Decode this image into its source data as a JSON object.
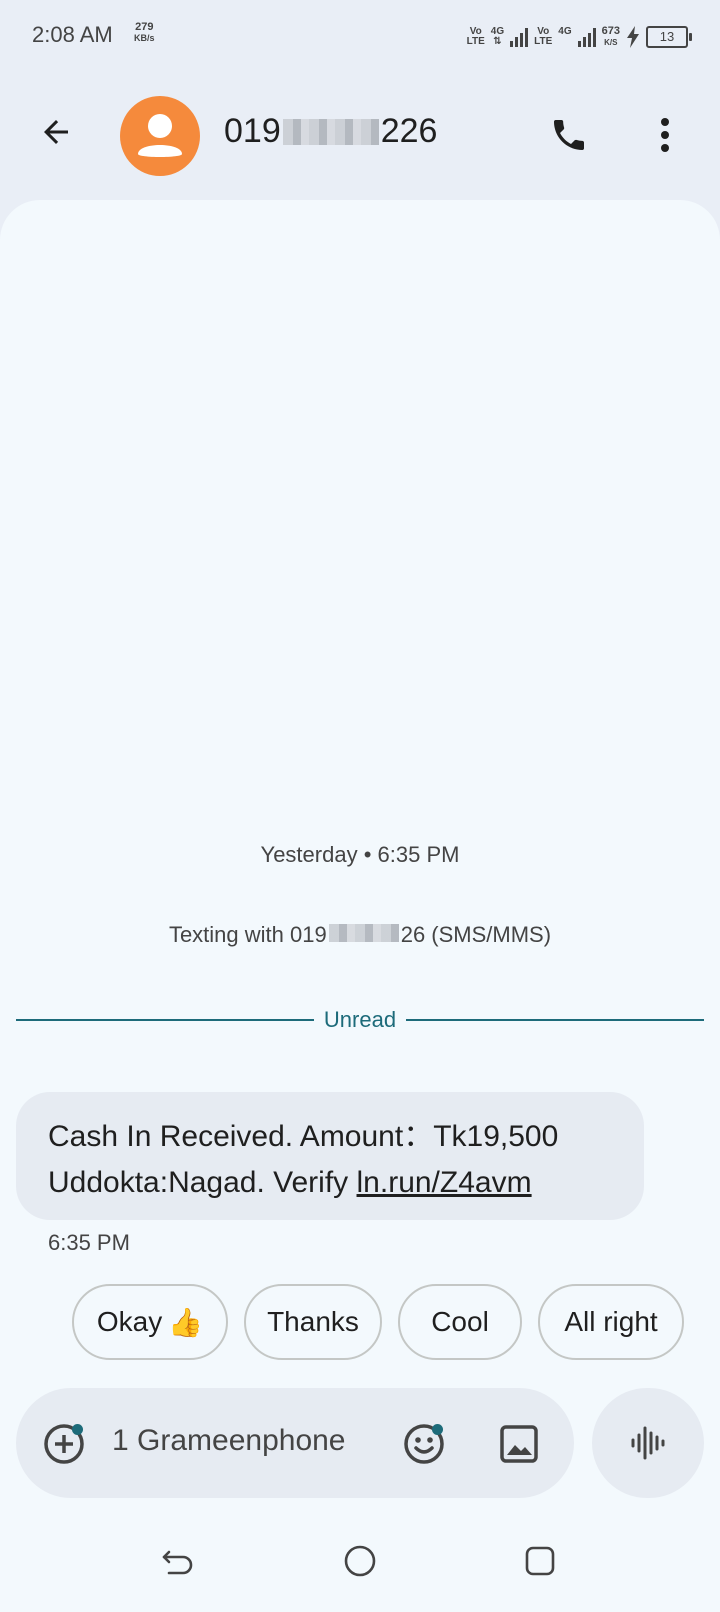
{
  "status_bar": {
    "time": "2:08 AM",
    "speed_value": "279",
    "speed_unit": "KB/s",
    "volte_label_1": "Vo",
    "volte_label_2": "LTE",
    "net_type": "4G",
    "net_speed_value": "673",
    "net_speed_unit": "K/S",
    "battery_level": "13"
  },
  "app_bar": {
    "contact_prefix": "019",
    "contact_suffix": "226",
    "back_icon": "arrow-left-icon",
    "call_icon": "phone-icon",
    "menu_icon": "more-vert-icon"
  },
  "conversation": {
    "date_label": "Yesterday • 6:35 PM",
    "texting_prefix": "Texting with 019",
    "texting_suffix": "26 (SMS/MMS)",
    "unread_label": "Unread",
    "message": {
      "line1": "Cash In Received. Amount：Tk19,500",
      "line2_text": "Uddokta:Nagad. Verify ",
      "link": "ln.run/Z4avm",
      "time": "6:35 PM"
    },
    "smart_replies": [
      {
        "label": "Okay",
        "emoji": "👍"
      },
      {
        "label": "Thanks"
      },
      {
        "label": "Cool"
      },
      {
        "label": "All right"
      }
    ]
  },
  "compose": {
    "sim_label": "1 Grameenphone"
  },
  "colors": {
    "accent": "#1d6b7a",
    "avatar": "#f58a3c",
    "bubble": "#e6ebf2",
    "background": "#f3f9fd"
  }
}
